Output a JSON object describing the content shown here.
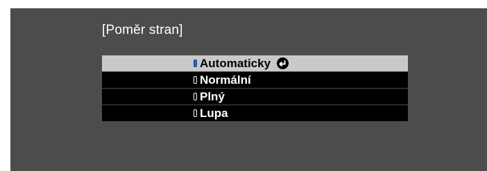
{
  "dialog": {
    "title": "[Poměr stran]"
  },
  "menu": {
    "items": [
      {
        "label": "Automaticky",
        "selected": true,
        "icon": "radio-selected-icon",
        "trailing_icon": "enter-icon"
      },
      {
        "label": "Normální",
        "selected": false,
        "icon": "radio-unselected-icon"
      },
      {
        "label": "Plný",
        "selected": false,
        "icon": "radio-unselected-icon"
      },
      {
        "label": "Lupa",
        "selected": false,
        "icon": "radio-unselected-icon"
      }
    ]
  },
  "colors": {
    "panel_background": "#4c4c4c",
    "row_background": "#000000",
    "highlight_background": "#c9c9c9",
    "radio_selected": "#2e64d2"
  }
}
